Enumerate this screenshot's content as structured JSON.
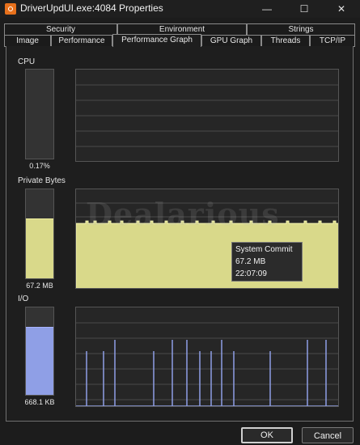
{
  "window": {
    "title": "DriverUpdUI.exe:4084 Properties",
    "minimize": "—",
    "maximize": "☐",
    "close": "✕"
  },
  "tabs_row1": [
    {
      "label": "Security"
    },
    {
      "label": "Environment"
    },
    {
      "label": "Strings"
    }
  ],
  "tabs_row2": [
    {
      "label": "Image"
    },
    {
      "label": "Performance"
    },
    {
      "label": "Performance Graph",
      "active": true
    },
    {
      "label": "GPU Graph"
    },
    {
      "label": "Threads"
    },
    {
      "label": "TCP/IP"
    }
  ],
  "cpu": {
    "label": "CPU",
    "value": "0.17%",
    "fill_fraction": 0.002,
    "color": "#3fae3f"
  },
  "private_bytes": {
    "label": "Private Bytes",
    "value": "67.2 MB",
    "fill_fraction": 0.66,
    "color": "#d9d98a"
  },
  "io": {
    "label": "I/O",
    "value": "668.1  KB",
    "fill_fraction": 0.77,
    "color": "#8f9fe6"
  },
  "tooltip": {
    "line1": "System Commit",
    "line2": "67.2 MB",
    "line3": "22:07:09"
  },
  "watermark": "Dealarious",
  "buttons": {
    "ok": "OK",
    "cancel": "Cancel"
  }
}
